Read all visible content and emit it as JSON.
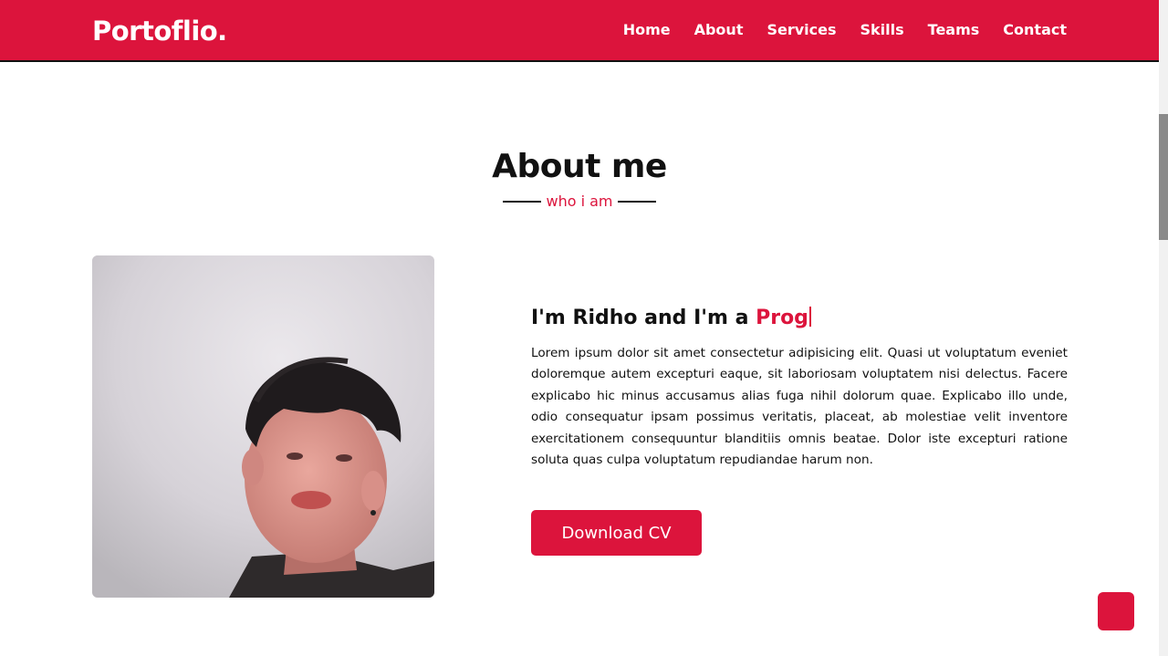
{
  "navbar": {
    "logo": "Portoflio.",
    "links": [
      "Home",
      "About",
      "Services",
      "Skills",
      "Teams",
      "Contact"
    ]
  },
  "about": {
    "title": "About me",
    "subtitle": "who i am",
    "heading_prefix": "I'm Ridho and I'm a ",
    "typed_text": "Prog",
    "paragraph": "Lorem ipsum dolor sit amet consectetur adipisicing elit. Quasi ut voluptatum eveniet doloremque autem excepturi eaque, sit laboriosam voluptatem nisi delectus. Facere explicabo hic minus accusamus alias fuga nihil dolorum quae. Explicabo illo unde, odio consequatur ipsam possimus veritatis, placeat, ab molestiae velit inventore exercitationem consequuntur blanditiis omnis beatae. Dolor iste excepturi ratione soluta quas culpa voluptatum repudiandae harum non.",
    "button_label": "Download CV"
  },
  "colors": {
    "accent": "#dc143c",
    "text": "#111111",
    "background": "#ffffff"
  },
  "icons": {
    "scroll_up": "arrow-up-icon"
  }
}
